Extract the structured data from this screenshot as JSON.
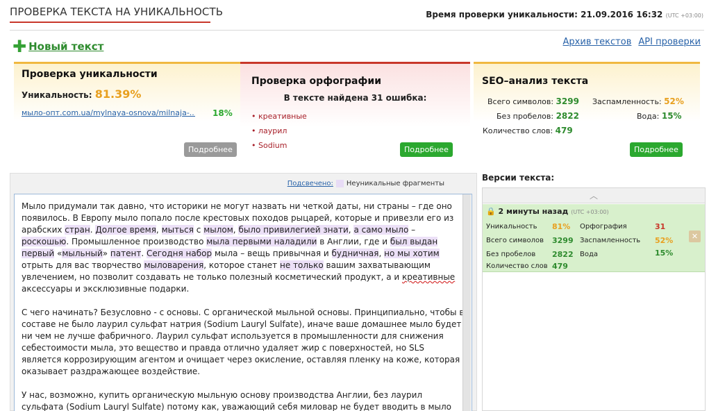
{
  "header": {
    "title": "ПРОВЕРКА ТЕКСТА НА УНИКАЛЬНОСТЬ",
    "time_label": "Время проверки уникальности: 21.09.2016 16:32",
    "time_tz": "(UTC +03:00)"
  },
  "actions": {
    "new_text": "Новый текст",
    "archive": "Архив текстов",
    "api": "API проверки"
  },
  "uniqueness_card": {
    "title": "Проверка уникальности",
    "label": "Уникальность:",
    "value": "81.39%",
    "source_url": "мыло-опт.com.ua/mylnaya-osnova/milnaja-...",
    "source_pct": "18%",
    "more": "Подробнее"
  },
  "spelling_card": {
    "title": "Проверка орфографии",
    "summary": "В тексте найдена 31 ошибка:",
    "errors": [
      "креативные",
      "лаурил",
      "Sodium"
    ],
    "more": "Подробнее"
  },
  "seo_card": {
    "title": "SEO–анализ текста",
    "chars_label": "Всего символов:",
    "chars": "3299",
    "nospace_label": "Без пробелов:",
    "nospace": "2822",
    "words_label": "Количество слов:",
    "words": "479",
    "spam_label": "Заспамленность:",
    "spam": "52%",
    "water_label": "Вода:",
    "water": "15%",
    "more": "Подробнее"
  },
  "legend": {
    "highlighted": "Подсвечено:",
    "nonunique": "Неуникальные фрагменты"
  },
  "text": {
    "p1": [
      [
        "Мыло придумали так давно, что историки не могут назвать ни четкой даты, ни страны – где оно появилось. В Европу мыло попало после крестовых походов рыцарей, которые и привезли его из арабских ",
        ""
      ],
      [
        "стран",
        "h"
      ],
      [
        ". ",
        ""
      ],
      [
        "Долгое время",
        "h"
      ],
      [
        ", ",
        ""
      ],
      [
        "мыться",
        "h"
      ],
      [
        " с ",
        ""
      ],
      [
        "мылом",
        "h"
      ],
      [
        ", ",
        ""
      ],
      [
        "было привилегией знати",
        "h"
      ],
      [
        ", ",
        ""
      ],
      [
        "а само мыло",
        "h"
      ],
      [
        " – ",
        ""
      ],
      [
        "роскошью",
        "h"
      ],
      [
        ". Промышленное производство ",
        ""
      ],
      [
        "мыла первыми наладили",
        "h"
      ],
      [
        " в Англии, где и ",
        ""
      ],
      [
        "был выдан первый",
        "h"
      ],
      [
        " «",
        ""
      ],
      [
        "мыльный",
        "h"
      ],
      [
        "» ",
        ""
      ],
      [
        "патент",
        "h"
      ],
      [
        ". ",
        ""
      ],
      [
        "Сегодня набор",
        "h"
      ],
      [
        " мыла – вещь привычная и ",
        ""
      ],
      [
        "будничная",
        "h"
      ],
      [
        ", ",
        ""
      ],
      [
        "но мы хотим",
        "h"
      ],
      [
        " отрыть для вас творчество ",
        ""
      ],
      [
        "мыловарения",
        "h"
      ],
      [
        ", которое станет ",
        ""
      ],
      [
        "не только",
        "h"
      ],
      [
        " вашим захватывающим увлечением, но позволит создавать не только полезный косметический продукт, а и ",
        ""
      ],
      [
        "креативные",
        "sp"
      ],
      [
        " аксессуары и эксклюзивные подарки.",
        ""
      ]
    ],
    "p2": "С чего начинать? Безусловно - с основы. С органической мыльной основы. Принципиально, чтобы в составе не было лаурил сульфат натрия (Sodium Lauryl Sulfate), иначе ваше домашнее мыло будет ни чем не лучше фабричного. Лаурил сульфат используется в промышленности для снижения себестоимости мыла, это вещество и правда отлично удаляет жир с поверхностей, но SLS является коррозирующим агентом и очищает через окисление, оставляя пленку на коже, которая оказывает раздражающее воздействие.",
    "p3": "У нас, возможно, купить органическую мыльную основу производства Англии, без лаурил сульфата (Sodium Lauryl Sulfate) потому как, уважающий себя миловар не будет вводить в мыло синтетические пенообразователи SLS."
  },
  "versions": {
    "title": "Версии текста:",
    "item": {
      "time": "2 минуты назад",
      "tz": "(UTC +03:00)",
      "uniq_label": "Уникальность",
      "uniq": "81%",
      "chars_label": "Всего символов",
      "chars": "3299",
      "nospace_label": "Без пробелов",
      "nospace": "2822",
      "words_label": "Количество слов",
      "words": "479",
      "spell_label": "Орфография",
      "spell": "31",
      "spam_label": "Заспамленность",
      "spam": "52%",
      "water_label": "Вода",
      "water": "15%"
    }
  },
  "colors": {
    "accent_red": "#c8372a",
    "accent_green": "#2ba82f",
    "accent_orange": "#e8a020",
    "link_blue": "#2862a8"
  }
}
